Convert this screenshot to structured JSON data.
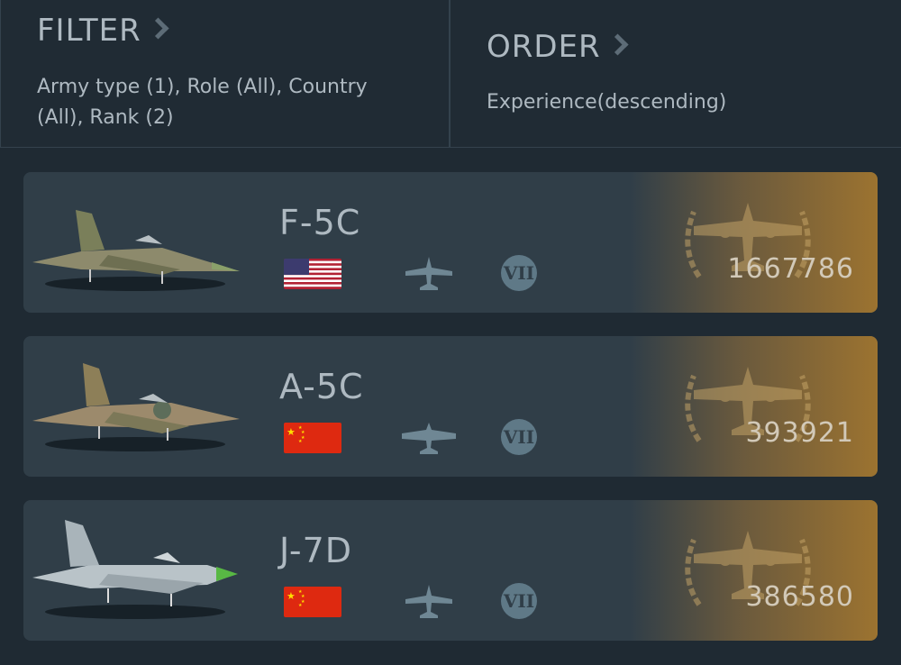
{
  "filter": {
    "title": "FILTER",
    "description": "Army type (1), Role (All), Country (All), Rank (2)"
  },
  "order": {
    "title": "ORDER",
    "description": "Experience(descending)"
  },
  "vehicles": [
    {
      "name": "F-5C",
      "country": "USA",
      "flag_icon": "usa-flag-icon",
      "type_icon": "fighter-icon",
      "rank": "VII",
      "experience": "1667786"
    },
    {
      "name": "A-5C",
      "country": "China",
      "flag_icon": "china-flag-icon",
      "type_icon": "attacker-icon",
      "rank": "VII",
      "experience": "393921"
    },
    {
      "name": "J-7D",
      "country": "China",
      "flag_icon": "china-flag-icon",
      "type_icon": "fighter-icon",
      "rank": "VII",
      "experience": "386580"
    }
  ],
  "colors": {
    "background": "#1f2a33",
    "card": "#303e48",
    "accent_gold": "#9c7330",
    "text": "#aeb9c1"
  }
}
